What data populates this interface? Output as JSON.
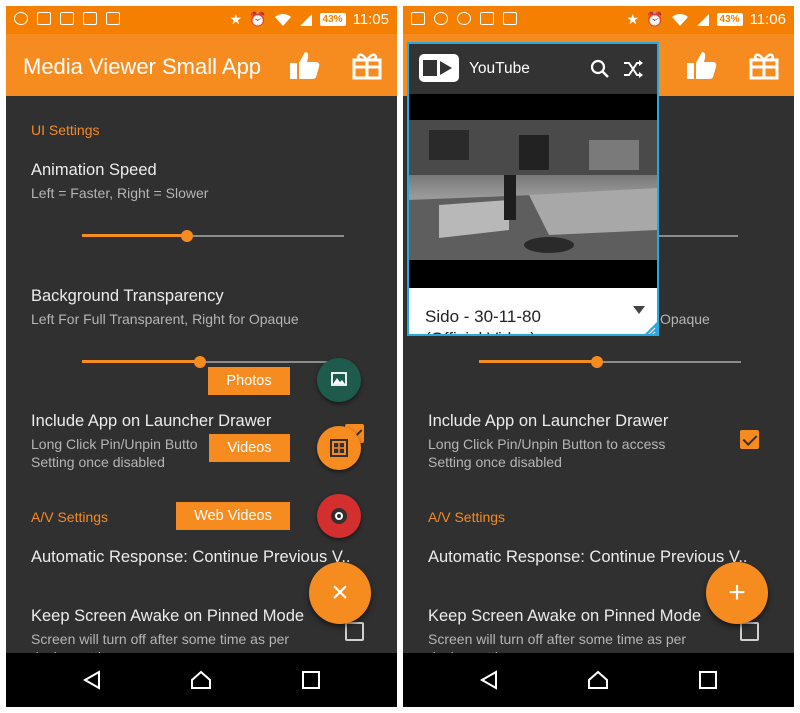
{
  "left": {
    "status_time": "11:05",
    "battery": "43%",
    "app_title": "Media Viewer Small App",
    "ui_section": "UI Settings",
    "animation_speed": {
      "title": "Animation Speed",
      "summary": "Left = Faster, Right = Slower",
      "level": 0.4
    },
    "bg_transparency": {
      "title": "Background Transparency",
      "summary": "Left For Full Transparent, Right for Opaque",
      "level": 0.45
    },
    "launcher": {
      "title": "Include App on Launcher Drawer",
      "summary_line1": "Long Click Pin/Unpin Butto",
      "summary_line2": "Setting once disabled"
    },
    "av_section": "A/V Settings",
    "auto_response": "Automatic Response: Continue Previous V..",
    "screen_awake": {
      "title": "Keep Screen Awake on Pinned Mode",
      "summary_line1": "Screen will turn off after some time as per",
      "summary_line2": "device setting"
    },
    "fab_menu": {
      "photos": "Photos",
      "videos": "Videos",
      "web_videos": "Web Videos"
    },
    "fab_close": "×"
  },
  "right": {
    "status_time": "11:06",
    "battery": "43%",
    "bg_summary_tail": "Opaque",
    "bg_level": 0.45,
    "launcher": {
      "title": "Include App on Launcher Drawer",
      "summary_line1": "Long Click Pin/Unpin Button to access",
      "summary_line2": "Setting once disabled",
      "checked": true
    },
    "av_section": "A/V Settings",
    "auto_response": "Automatic Response: Continue Previous V..",
    "screen_awake": {
      "title": "Keep Screen Awake on Pinned Mode",
      "summary_line1": "Screen will turn off after some time as per",
      "summary_line2": "device setting"
    },
    "fab_add": "+",
    "youtube": {
      "title": "YouTube",
      "video_caption_line1": "Sido - 30-11-80",
      "video_caption_line2": "(Official Video)"
    }
  },
  "colors": {
    "accent": "#f68b1f",
    "status_bar": "#f47f00",
    "background": "#303030",
    "photos_fab": "#1e5b4d",
    "videos_fab": "#f68b1f",
    "web_fab": "#d32f2f",
    "popup_border": "#29a8e0"
  },
  "icons": [
    "usb-icon",
    "image-icon",
    "mail-icon",
    "edit-icon",
    "clipboard-icon",
    "star-icon",
    "alarm-icon",
    "wifi-icon",
    "signal-icon",
    "thumbs-up-icon",
    "gift-icon",
    "search-icon",
    "shuffle-icon",
    "back-icon",
    "home-icon",
    "recents-icon"
  ]
}
